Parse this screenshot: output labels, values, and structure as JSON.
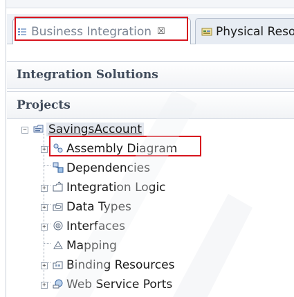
{
  "tabs": [
    {
      "label": "Business Integration",
      "close": "☒"
    },
    {
      "label": "Physical Reso"
    }
  ],
  "sections": {
    "integration_solutions": "Integration Solutions",
    "projects": "Projects"
  },
  "tree": {
    "root": {
      "label": "SavingsAccount",
      "toggle": "⊟"
    },
    "items": [
      {
        "label": "Assembly Diagram",
        "toggle": "+",
        "icon": "assembly-diagram-icon"
      },
      {
        "label": "Dependencies",
        "icon": "dependencies-icon"
      },
      {
        "label": "Integration Logic",
        "toggle": "+",
        "icon": "integration-logic-icon"
      },
      {
        "label": "Data Types",
        "toggle": "+",
        "icon": "data-types-icon"
      },
      {
        "label": "Interfaces",
        "toggle": "+",
        "icon": "interfaces-icon"
      },
      {
        "label": "Mapping",
        "icon": "mapping-icon"
      },
      {
        "label": "Binding Resources",
        "toggle": "+",
        "icon": "binding-resources-icon"
      },
      {
        "label": "Web Service Ports",
        "toggle": "+",
        "icon": "web-service-ports-icon"
      }
    ]
  },
  "colors": {
    "highlight": "#d7141e",
    "section_title": "#3f4a5a"
  }
}
